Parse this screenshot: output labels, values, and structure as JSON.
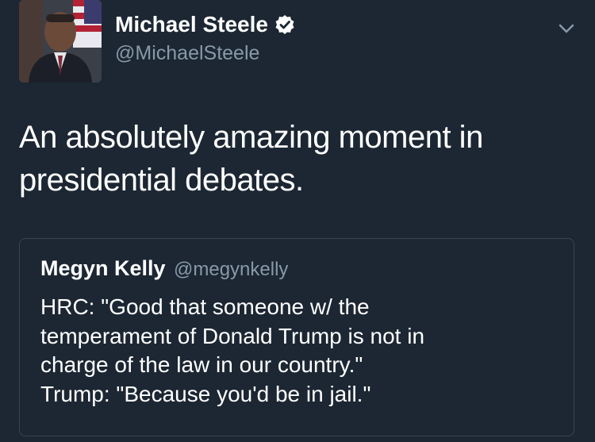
{
  "tweet": {
    "author": {
      "display_name": "Michael Steele",
      "handle": "@MichaelSteele",
      "verified": true
    },
    "text_lines": [
      "An absolutely amazing moment in",
      "presidential debates."
    ],
    "menu_icon": "chevron-down-icon",
    "quoted_tweet": {
      "display_name": "Megyn Kelly",
      "handle": "@megynkelly",
      "text_lines": [
        "HRC: \"Good that someone w/ the",
        "temperament of Donald Trump is not in",
        "charge of the law in our country.\"",
        "Trump: \"Because you'd be in jail.\""
      ]
    }
  },
  "colors": {
    "background": "#1c2733",
    "primary_text": "#ffffff",
    "secondary_text": "#8899a6",
    "border": "#38444d"
  }
}
